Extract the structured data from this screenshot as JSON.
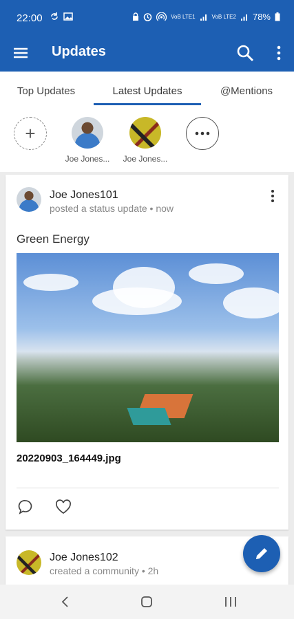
{
  "status_bar": {
    "time": "22:00",
    "battery": "78%",
    "net1": "VoB LTE1",
    "net2": "VoB LTE2"
  },
  "app_bar": {
    "title": "Updates"
  },
  "tabs": [
    {
      "label": "Top Updates",
      "active": false
    },
    {
      "label": "Latest Updates",
      "active": true
    },
    {
      "label": "@Mentions",
      "active": false
    }
  ],
  "people": [
    {
      "name": "Joe Jones..."
    },
    {
      "name": "Joe Jones..."
    }
  ],
  "posts": [
    {
      "author": "Joe Jones101",
      "meta": "posted a status update • now",
      "text": "Green Energy",
      "attachment": "20220903_164449.jpg"
    },
    {
      "author": "Joe Jones102",
      "meta": "created a community • 2h"
    }
  ],
  "colors": {
    "primary": "#1d5fb3",
    "background": "#ececec"
  }
}
